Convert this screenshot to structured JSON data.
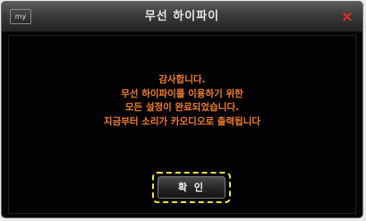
{
  "window": {
    "title": "무선 하이파이",
    "logo_text": "my",
    "close_glyph": "×",
    "icons": [
      "app-logo-icon",
      "close-icon"
    ]
  },
  "message": {
    "lines": [
      "감사합니다.",
      "무선 하이파이를 이용하기 위한",
      "모든 설정이 완료되었습니다.",
      "지금부터 소리가 카오디오로 출력됩니다"
    ],
    "color": "#f57f2a"
  },
  "confirm": {
    "label": "확 인",
    "focus_color": "#f2e33a"
  },
  "colors": {
    "title_text": "#e6e6e6",
    "close": "#e1301e",
    "background": "#050505"
  }
}
